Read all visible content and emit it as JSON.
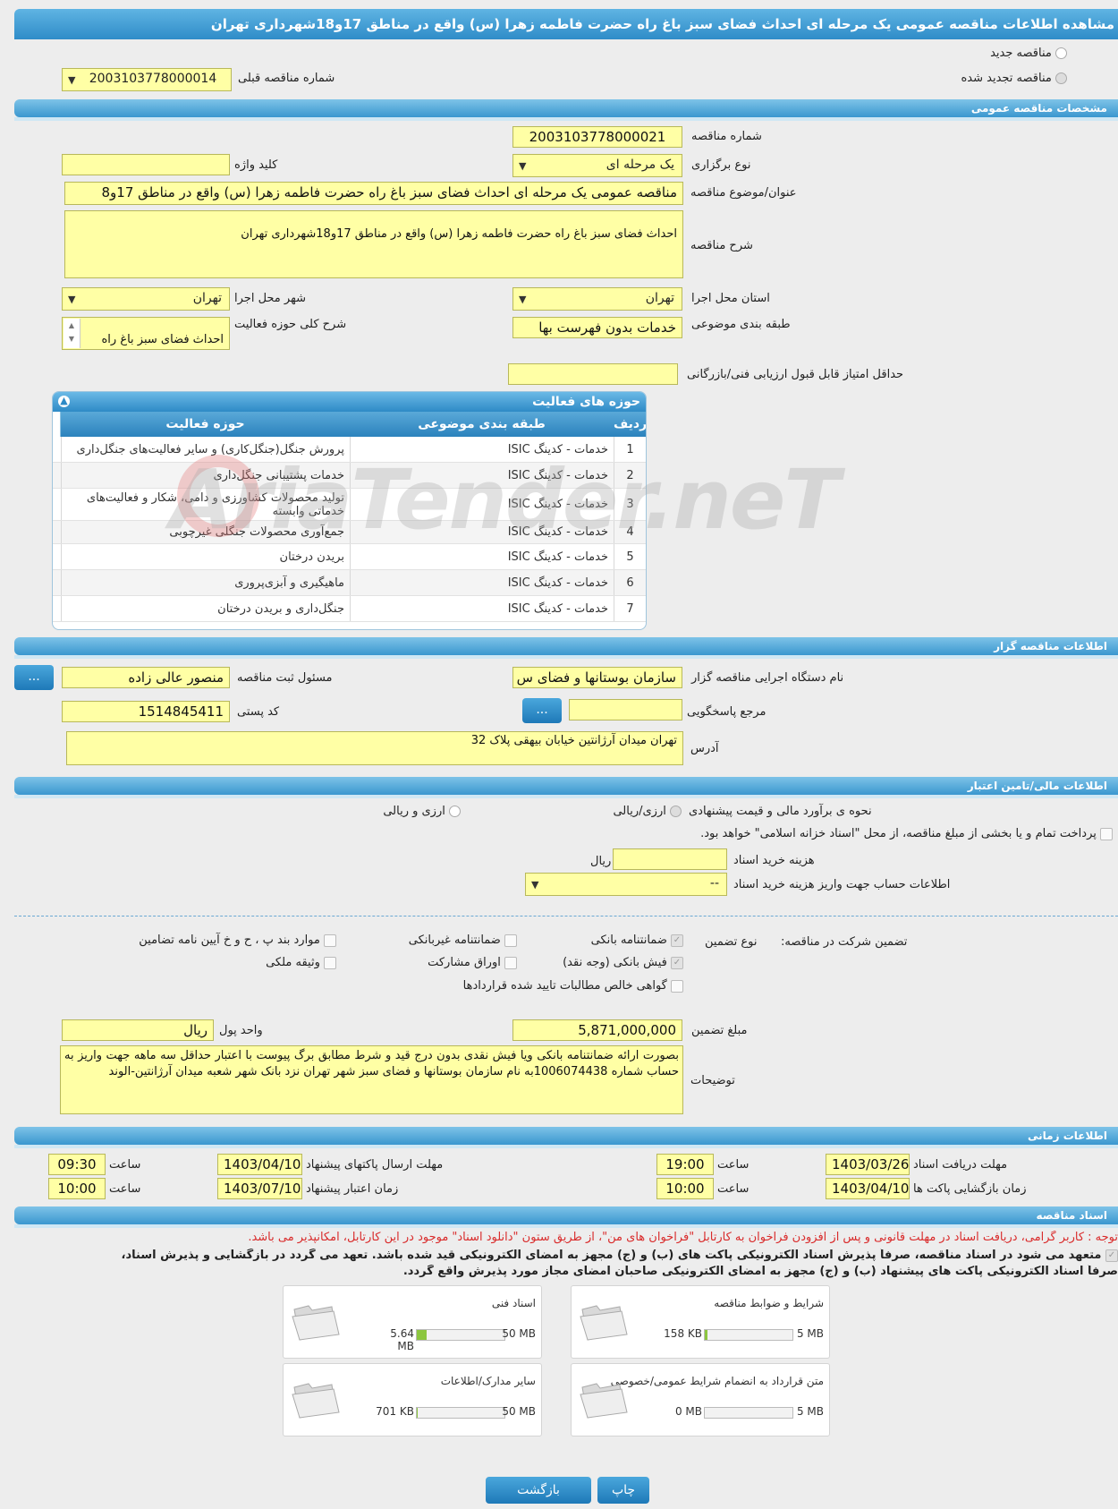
{
  "header": {
    "title": "مشاهده اطلاعات مناقصه عمومی یک مرحله ای احداث فضای سبز باغ راه حضرت فاطمه زهرا (س) واقع در مناطق 17و18شهرداری تهران"
  },
  "top": {
    "new_tender": "مناقصه جدید",
    "renewed_tender": "مناقصه تجدید شده",
    "prev_tender_label": "شماره مناقصه قبلی",
    "prev_tender_value": "2003103778000014"
  },
  "general": {
    "section": "مشخصات مناقصه عمومی",
    "number_label": "شماره مناقصه",
    "number_value": "2003103778000021",
    "type_label": "نوع برگزاری",
    "type_value": "یک مرحله ای",
    "keyword_label": "کلید واژه",
    "keyword_value": "",
    "subject_label": "عنوان/موضوع مناقصه",
    "subject_value": "مناقصه عمومی یک مرحله ای احداث فضای سبز باغ راه حضرت فاطمه زهرا (س) واقع در مناطق 17و8",
    "desc_label": "شرح مناقصه",
    "desc_value": "احداث فضای سبز باغ راه حضرت فاطمه زهرا (س) واقع در مناطق 17و18شهرداری تهران",
    "province_label": "استان محل اجرا",
    "province_value": "تهران",
    "city_label": "شهر محل اجرا",
    "city_value": "تهران",
    "category_label": "طبقه بندی موضوعی",
    "category_value": "خدمات بدون فهرست بها",
    "scope_label": "شرح کلی حوزه فعالیت",
    "scope_value": "احداث فضای سبز باغ راه",
    "min_score_label": "حداقل امتیاز قابل قبول ارزیابی فنی/بازرگانی",
    "min_score_value": ""
  },
  "activities": {
    "title": "حوزه های فعالیت",
    "col_idx": "ردیف",
    "col_cat": "طبقه بندی موضوعی",
    "col_act": "حوزه فعالیت",
    "rows": [
      {
        "idx": "1",
        "cat": "خدمات - کدینگ ISIC",
        "act": "پرورش جنگل(جنگل‌کاری) و سایر فعالیت‌های جنگل‌داری"
      },
      {
        "idx": "2",
        "cat": "خدمات - کدینگ ISIC",
        "act": "خدمات پشتیبانی جنگل‌داری"
      },
      {
        "idx": "3",
        "cat": "خدمات - کدینگ ISIC",
        "act": "تولید محصولات کشاورزی و دامی، شکار و فعالیت‌های خدماتی وابسته"
      },
      {
        "idx": "4",
        "cat": "خدمات - کدینگ ISIC",
        "act": "جمع‌آوری محصولات جنگلی غیرچوبی"
      },
      {
        "idx": "5",
        "cat": "خدمات - کدینگ ISIC",
        "act": "بریدن درختان"
      },
      {
        "idx": "6",
        "cat": "خدمات - کدینگ ISIC",
        "act": "ماهیگیری و آبزی‌پروری"
      },
      {
        "idx": "7",
        "cat": "خدمات - کدینگ ISIC",
        "act": "جنگل‌داری و بریدن درختان"
      }
    ],
    "watermark": "AriaTender.neT"
  },
  "organizer": {
    "section": "اطلاعات مناقصه گزار",
    "org_label": "نام دستگاه اجرایی مناقصه گزار",
    "org_value": "سازمان بوستانها و فضای س",
    "registrar_label": "مسئول ثبت مناقصه",
    "registrar_value": "منصور عالی زاده",
    "ref_label": "مرجع پاسخگویی",
    "ref_value": "",
    "postal_label": "کد پستی",
    "postal_value": "1514845411",
    "address_label": "آدرس",
    "address_value": "تهران میدان آرژانتین خیابان بیهقی پلاک 32",
    "more_button": "..."
  },
  "finance": {
    "section": "اطلاعات مالی/تامین اعتبار",
    "estimate_label": "نحوه ی برآورد مالی و قیمت پیشنهادی",
    "opt_rial": "ارزی/ریالی",
    "opt_fx": "ارزی و ریالی",
    "treasury_text": "پرداخت تمام و یا بخشی از مبلغ مناقصه، از محل \"اسناد خزانه اسلامی\" خواهد بود.",
    "doc_cost_label": "هزینه خرید اسناد",
    "doc_cost_value": "",
    "doc_cost_unit": "ریال",
    "account_label": "اطلاعات حساب جهت واریز هزینه خرید اسناد",
    "account_value": "--"
  },
  "guarantee": {
    "title": "تضمین شرکت در مناقصه:",
    "type_label": "نوع تضمین",
    "bank_guarantee": "ضمانتنامه بانکی",
    "non_bank_guarantee": "ضمانتنامه غیربانکی",
    "items_clause": "موارد بند پ ، ح و خ آیین نامه تضامین",
    "bank_receipt": "فیش بانکی (وجه نقد)",
    "bonds": "اوراق مشارکت",
    "property": "وثیقه ملکی",
    "net_claims": "گواهی خالص مطالبات تایید شده قراردادها",
    "amount_label": "مبلغ تضمین",
    "amount_value": "5,871,000,000",
    "currency_label": "واحد پول",
    "currency_value": "ریال",
    "notes_label": "توضیحات",
    "notes_value": "بصورت ارائه ضمانتنامه بانکی ویا فیش نقدی بدون درج قید و شرط مطابق برگ پیوست با اعتبار حداقل سه ماهه جهت واریز به حساب شماره 1006074438به نام سازمان بوستانها و فضای سبز شهر تهران نزد بانک شهر شعبه میدان آرژانتین-الوند"
  },
  "timing": {
    "section": "اطلاعات زمانی",
    "doc_deadline_label": "مهلت دریافت اسناد",
    "doc_deadline_date": "1403/03/26",
    "doc_deadline_time": "19:00",
    "submit_deadline_label": "مهلت ارسال پاکتهای پیشنهاد",
    "submit_deadline_date": "1403/04/10",
    "submit_deadline_time": "09:30",
    "opening_label": "زمان بازگشایی پاکت ها",
    "opening_date": "1403/04/10",
    "opening_time": "10:00",
    "validity_label": "زمان اعتبار پیشنهاد",
    "validity_date": "1403/07/10",
    "validity_time": "10:00",
    "time_label": "ساعت"
  },
  "documents": {
    "section": "اسناد مناقصه",
    "notice": "توجه : کاربر گرامی، دریافت اسناد در مهلت قانونی و پس از افزودن فراخوان به کارتابل \"فراخوان های من\"، از طریق ستون \"دانلود اسناد\" موجود در این کارتابل، امکانپذیر می باشد.",
    "commit_line1": "متعهد می شود در اسناد مناقصه، صرفاً پذیرش اسناد الکترونیکی پاکت های (ب) و (ج) مجهز به امضای الکترونیکی قید شده باشد. تعهد می گردد در بازگشایی و پذیرش اسناد،",
    "commit_line2": "صرفاً اسناد الکترونیکی پاکت های پیشنهاد (ب) و (ج) مجهز به امضای الکترونیکی صاحبان امضای مجاز مورد پذیرش واقع گردد.",
    "cards": [
      {
        "name": "شرایط و ضوابط مناقصه",
        "current": "158 KB",
        "max": "5 MB",
        "fraction": 0.03
      },
      {
        "name": "اسناد فنی",
        "current": "5.64 MB",
        "max": "50 MB",
        "fraction": 0.113
      },
      {
        "name": "متن قرارداد به انضمام شرایط عمومی/خصوصی",
        "current": "0 MB",
        "max": "5 MB",
        "fraction": 0.0
      },
      {
        "name": "سایر مدارک/اطلاعات",
        "current": "701 KB",
        "max": "50 MB",
        "fraction": 0.014
      }
    ]
  },
  "footer": {
    "back": "بازگشت",
    "print": "چاپ"
  },
  "colors": {
    "accent": "#2f8cc8",
    "field": "#ffffa5",
    "notice": "#d92b2b",
    "progress": "#8cc63f"
  }
}
